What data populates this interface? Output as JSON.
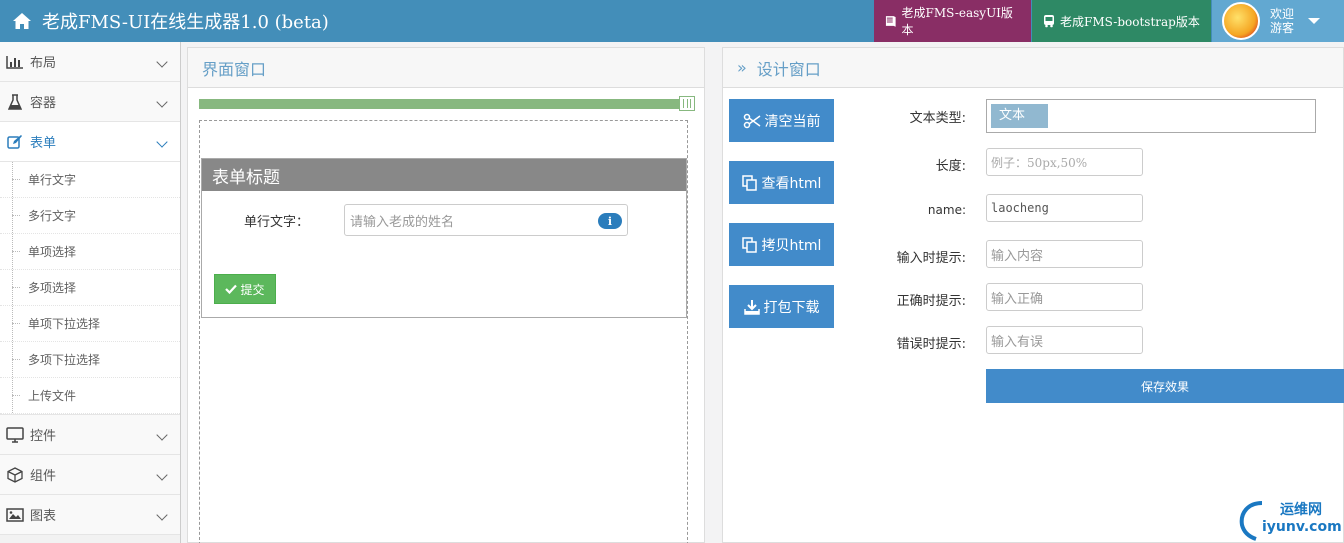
{
  "header": {
    "title": "老成FMS-UI在线生成器1.0 (beta)",
    "nav_easyui": "老成FMS-easyUI版本",
    "nav_bootstrap": "老成FMS-bootstrap版本",
    "welcome_line1": "欢迎",
    "welcome_line2": "游客"
  },
  "sidebar": {
    "items": [
      {
        "label": "布局",
        "icon": "bar-chart-icon"
      },
      {
        "label": "容器",
        "icon": "flask-icon"
      },
      {
        "label": "表单",
        "icon": "edit-icon",
        "active": true
      },
      {
        "label": "控件",
        "icon": "desktop-icon"
      },
      {
        "label": "组件",
        "icon": "cube-icon"
      },
      {
        "label": "图表",
        "icon": "picture-icon"
      }
    ],
    "form_subitems": [
      "单行文字",
      "多行文字",
      "单项选择",
      "多项选择",
      "单项下拉选择",
      "多项下拉选择",
      "上传文件"
    ]
  },
  "interface_panel": {
    "title": "界面窗口",
    "form": {
      "title": "表单标题",
      "field_label": "单行文字：",
      "field_placeholder": "请输入老成的姓名",
      "info_glyph": "i",
      "submit_label": "提交"
    }
  },
  "design_panel": {
    "title": "设计窗口",
    "buttons": [
      "清空当前",
      "查看html",
      "拷贝html",
      "打包下载"
    ],
    "fields": {
      "type_label": "文本类型:",
      "type_value": "文本",
      "length_label": "长度:",
      "length_placeholder": "例子：50px,50%",
      "name_label": "name:",
      "name_value": "laocheng",
      "input_hint_label": "输入时提示:",
      "input_hint_placeholder": "输入内容",
      "correct_hint_label": "正确时提示:",
      "correct_hint_placeholder": "输入正确",
      "error_hint_label": "错误时提示:",
      "error_hint_placeholder": "输入有误"
    },
    "save_label": "保存效果"
  },
  "watermark": {
    "line1": "运维网",
    "line2": "iyunv.com"
  },
  "colors": {
    "header": "#438eb9",
    "easyui": "#892e65",
    "bootstrap": "#2e8965",
    "primary": "#428bca",
    "success": "#5cb85c"
  }
}
